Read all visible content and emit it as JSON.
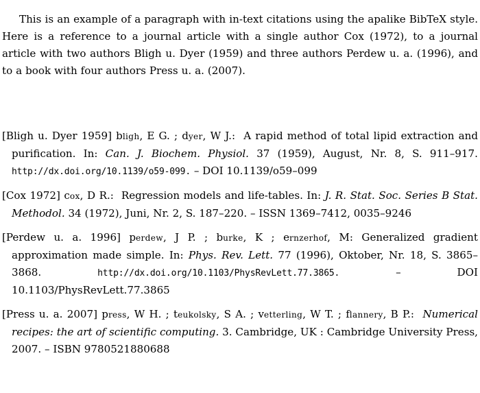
{
  "document": {
    "type": "latex-bibliography-page",
    "background_color": "#ffffff",
    "text_color": "#000000"
  },
  "intro": {
    "text": "This is an example of a paragraph with in-text citations using the apalike BibTeX style. Here is a reference to a journal article with a single author Cox (1972), to a journal article with two authors Bligh u. Dyer (1959) and three authors Perdew u. a. (1996), and to a book with four authors Press u. a. (2007)."
  },
  "bibliography": {
    "entries": [
      {
        "key": "bligh-dyer-1959",
        "label": "[Bligh u. Dyer 1959]",
        "authors": [
          {
            "last_first": "B",
            "last_rest": "LIGH",
            "initials": "E G."
          },
          {
            "last_first": "D",
            "last_rest": "YER",
            "initials": "W J."
          }
        ],
        "author_separator": " ; ",
        "title": "A rapid method of total lipid extraction and purification.",
        "in_label": "In:",
        "journal": "Can. J. Biochem. Physiol.",
        "volume": "37",
        "year": "(1959),",
        "month": "August,",
        "number": "Nr. 8,",
        "pages": "S. 911–917.",
        "url": "http://dx.doi.org/10.1139/o59-099.",
        "doi_note": "– DOI 10.1139/o59–099"
      },
      {
        "key": "cox-1972",
        "label": "[Cox 1972]",
        "authors": [
          {
            "last_first": "C",
            "last_rest": "OX",
            "initials": "D R."
          }
        ],
        "author_separator": "",
        "title": "Regression models and life-tables.",
        "in_label": "In:",
        "journal": "J. R. Stat. Soc. Series B Stat. Methodol.",
        "volume": "34",
        "year": "(1972),",
        "month": "Juni,",
        "number": "Nr. 2,",
        "pages": "S. 187–220.",
        "issn_note": "– ISSN 1369–7412, 0035–9246"
      },
      {
        "key": "perdew-1996",
        "label": "[Perdew u. a. 1996]",
        "authors": [
          {
            "last_first": "P",
            "last_rest": "ERDEW",
            "initials": "J P."
          },
          {
            "last_first": "B",
            "last_rest": "URKE",
            "initials": "K"
          },
          {
            "last_first": "E",
            "last_rest": "RNZERHOF",
            "initials": "M"
          }
        ],
        "author_separator": " ; ",
        "title": "Generalized gradient approximation made simple.",
        "in_label": "In:",
        "journal": "Phys. Rev. Lett.",
        "volume": "77",
        "year": "(1996),",
        "month": "Oktober,",
        "number": "Nr. 18,",
        "pages": "S. 3865–3868.",
        "url": "http://dx.doi.org/10.1103/PhysRevLett.77.3865.",
        "doi_note": "– DOI 10.1103/PhysRevLett.77.3865"
      },
      {
        "key": "press-2007",
        "label": "[Press u. a. 2007]",
        "authors": [
          {
            "last_first": "P",
            "last_rest": "RESS",
            "initials": "W H."
          },
          {
            "last_first": "T",
            "last_rest": "EUKOLSKY",
            "initials": "S A."
          },
          {
            "last_first": "V",
            "last_rest": "ETTERLING",
            "initials": "W T."
          },
          {
            "last_first": "F",
            "last_rest": "LANNERY",
            "initials": "B P."
          }
        ],
        "author_separator": " ; ",
        "title": "Numerical recipes: the art of scientific computing.",
        "edition": "3.",
        "address_publisher": "Cambridge, UK : Cambridge University Press, 2007.",
        "isbn_note": "– ISBN 9780521880688"
      }
    ]
  }
}
